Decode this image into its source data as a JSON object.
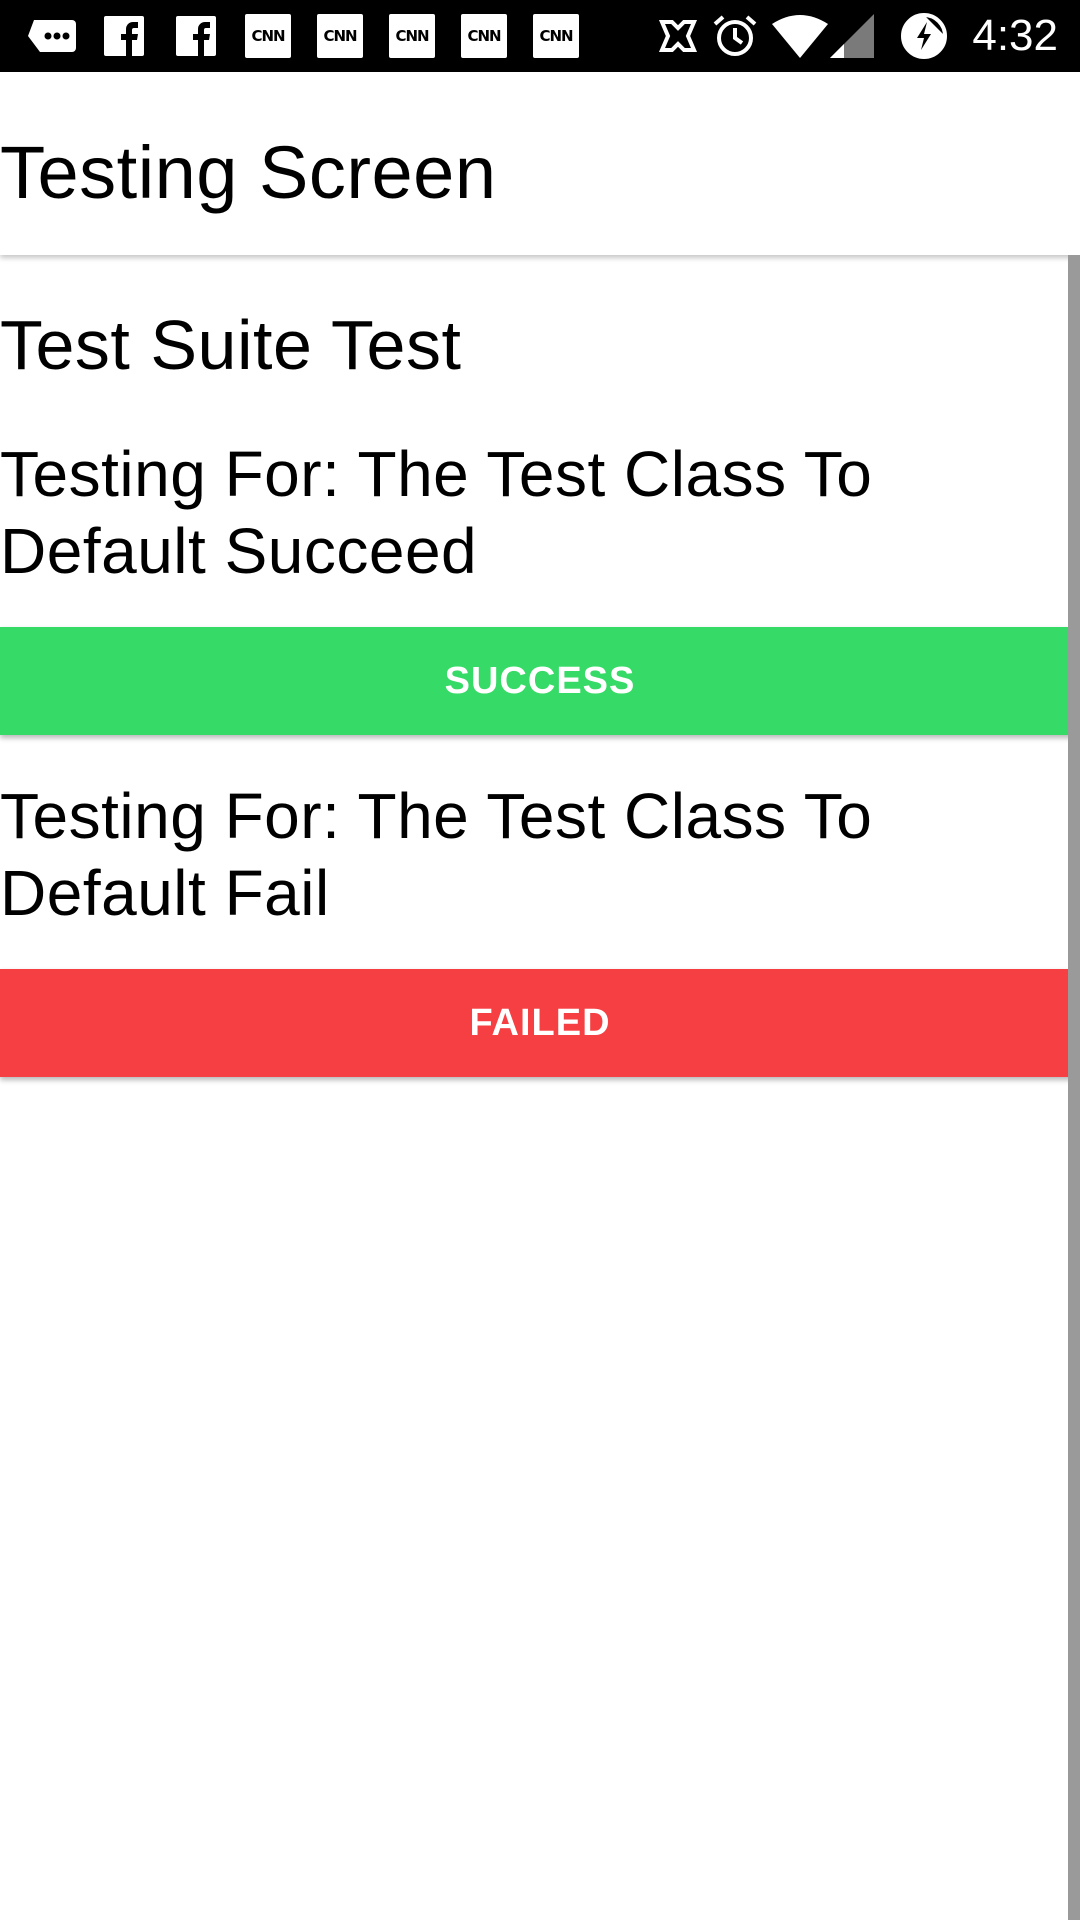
{
  "status_bar": {
    "time": "4:32",
    "notification_icons": [
      "chat-bubble-icon",
      "facebook-icon",
      "facebook-icon",
      "cnn-icon",
      "cnn-icon",
      "cnn-icon",
      "cnn-icon",
      "cnn-icon"
    ],
    "cnn_label": "CNN",
    "system_icons": [
      "nfc-icon",
      "alarm-icon",
      "wifi-icon",
      "signal-icon",
      "battery-charging-icon"
    ]
  },
  "app_bar": {
    "title": "Testing Screen"
  },
  "suite": {
    "title": "Test Suite Test",
    "tests": [
      {
        "label": "Testing For: The Test Class To Default Succeed",
        "result": "SUCCESS",
        "status_color": "#36da66"
      },
      {
        "label": "Testing For: The Test Class To Default Fail",
        "result": "FAILED",
        "status_color": "#f63f42"
      }
    ]
  },
  "colors": {
    "status_bar_bg": "#000000",
    "app_bg": "#ffffff",
    "success": "#36da66",
    "failed": "#f63f42",
    "scrollbar": "#9a9a9a"
  }
}
